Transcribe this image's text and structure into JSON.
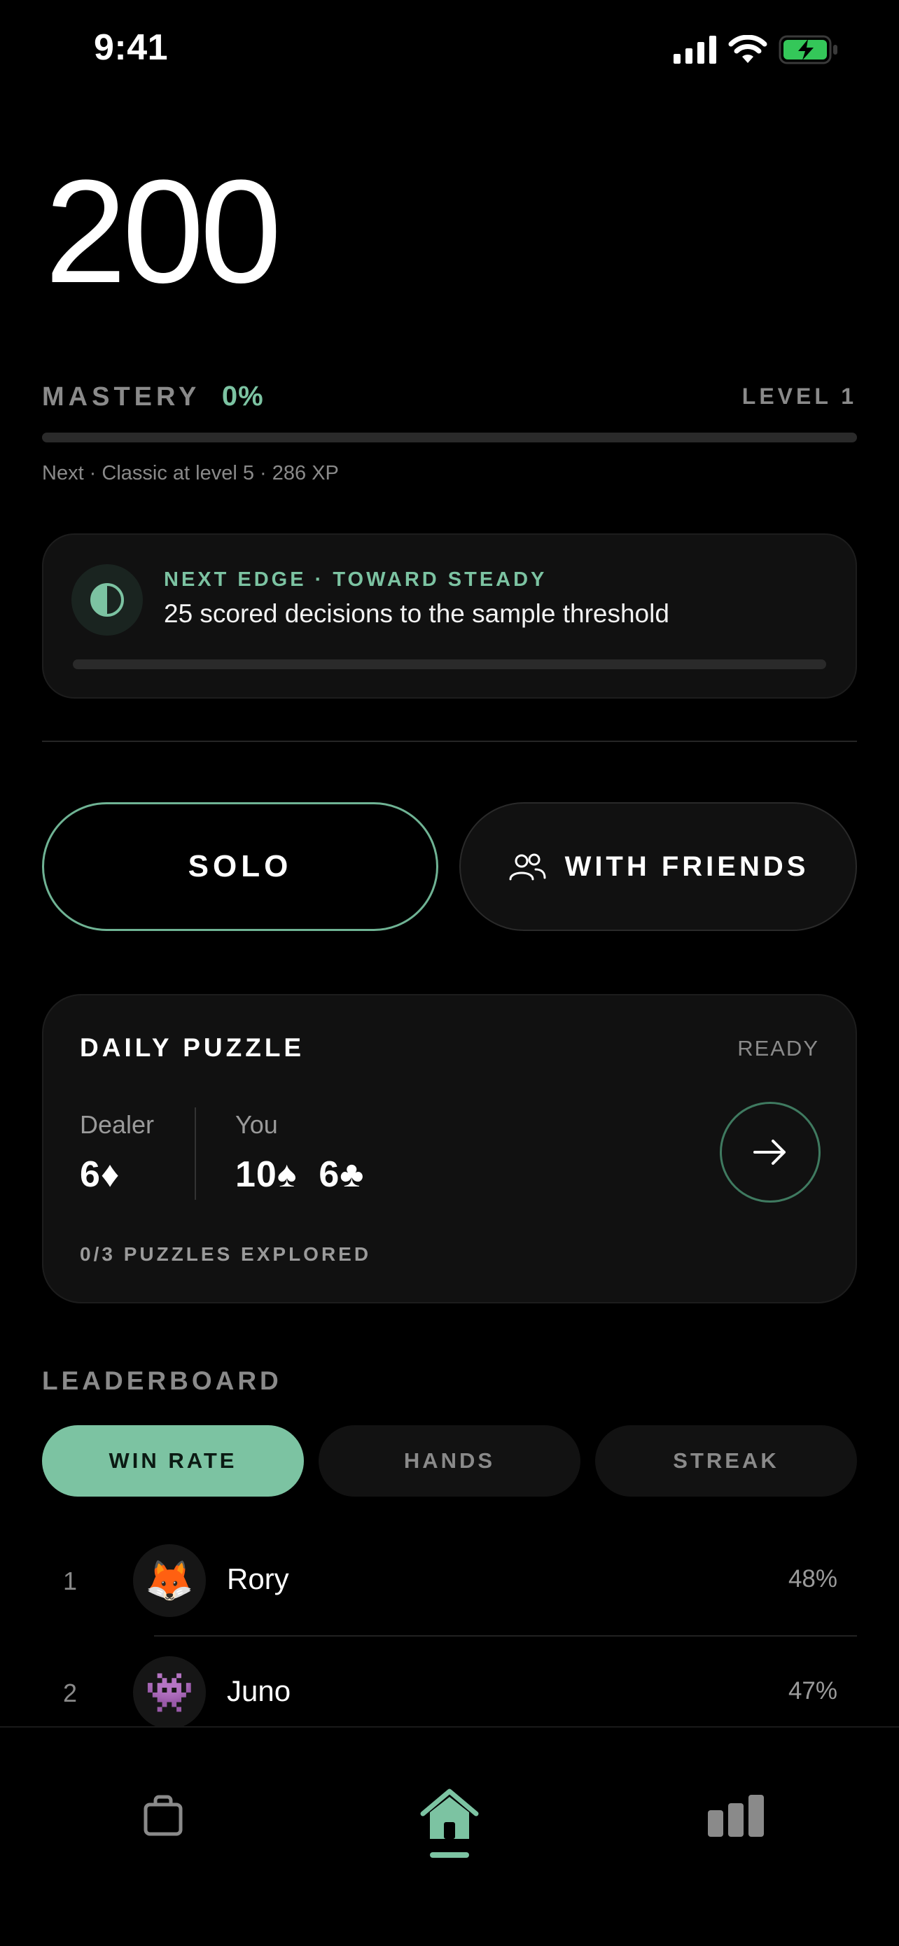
{
  "status_bar": {
    "time": "9:41"
  },
  "balance": "200",
  "mastery": {
    "label": "MASTERY",
    "percent": "0%",
    "progress": 0,
    "level": "LEVEL 1",
    "next": "Next · Classic at level 5 · 286 XP"
  },
  "edge": {
    "eyebrow": "NEXT EDGE · TOWARD STEADY",
    "text": "25 scored decisions to the sample threshold",
    "progress": 0
  },
  "modes": {
    "solo": "SOLO",
    "friends": "WITH FRIENDS"
  },
  "daily_puzzle": {
    "title": "DAILY PUZZLE",
    "status": "READY",
    "dealer_label": "Dealer",
    "dealer_cards": "6♦",
    "you_label": "You",
    "you_cards": "10♠  6♣",
    "explored": "0/3 PUZZLES EXPLORED"
  },
  "leaderboard": {
    "title": "LEADERBOARD",
    "tabs": [
      "WIN RATE",
      "HANDS",
      "STREAK"
    ],
    "active_tab": "WIN RATE",
    "rows": [
      {
        "rank": "1",
        "avatar": "🦊",
        "name": "Rory",
        "value": "48%"
      },
      {
        "rank": "2",
        "avatar": "👾",
        "name": "Juno",
        "value": "47%"
      }
    ]
  },
  "colors": {
    "accent": "#7cc3a2",
    "background": "#000000",
    "card": "#111111"
  },
  "tabbar": {
    "items": [
      "bag-icon",
      "home-icon",
      "stats-icon"
    ],
    "active": "home-icon"
  }
}
